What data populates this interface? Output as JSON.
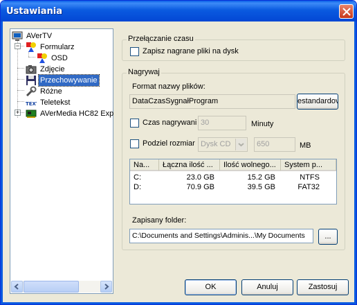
{
  "window": {
    "title": "Ustawiania"
  },
  "tree": {
    "items": [
      {
        "label": "AVerTV"
      },
      {
        "label": "Formularz"
      },
      {
        "label": "OSD"
      },
      {
        "label": "Zdjęcie"
      },
      {
        "label": "Przechowywanie"
      },
      {
        "label": "Różne"
      },
      {
        "label": "Teletekst"
      },
      {
        "label": "AVerMedia HC82 Exp"
      }
    ]
  },
  "time_shift": {
    "legend": "Przełączanie czasu",
    "checkbox_label": "Zapisz nagrane pliki na dysk"
  },
  "recording": {
    "legend": "Nagrywaj",
    "format_label": "Format nazwy plików:",
    "format_value": "DataCzasSygnałProgram",
    "default_button": "estandardov",
    "duration_label": "Czas nagrywani",
    "duration_value": "30",
    "duration_unit": "Minuty",
    "split_label": "Podziel rozmiar",
    "split_select": "Dysk CD",
    "split_value": "650",
    "split_unit": "MB",
    "columns": [
      "Na...",
      "Łączna ilość ...",
      "Ilość wolnego...",
      "System p..."
    ],
    "rows": [
      {
        "name": "C:",
        "total": "23.0 GB",
        "free": "15.2 GB",
        "fs": "NTFS"
      },
      {
        "name": "D:",
        "total": "70.9 GB",
        "free": "39.5 GB",
        "fs": "FAT32"
      }
    ],
    "folder_label": "Zapisany folder:",
    "folder_value": "C:\\Documents and Settings\\Adminis...\\My Documents",
    "browse_button": "..."
  },
  "buttons": {
    "ok": "OK",
    "cancel": "Anuluj",
    "apply": "Zastosuj"
  }
}
